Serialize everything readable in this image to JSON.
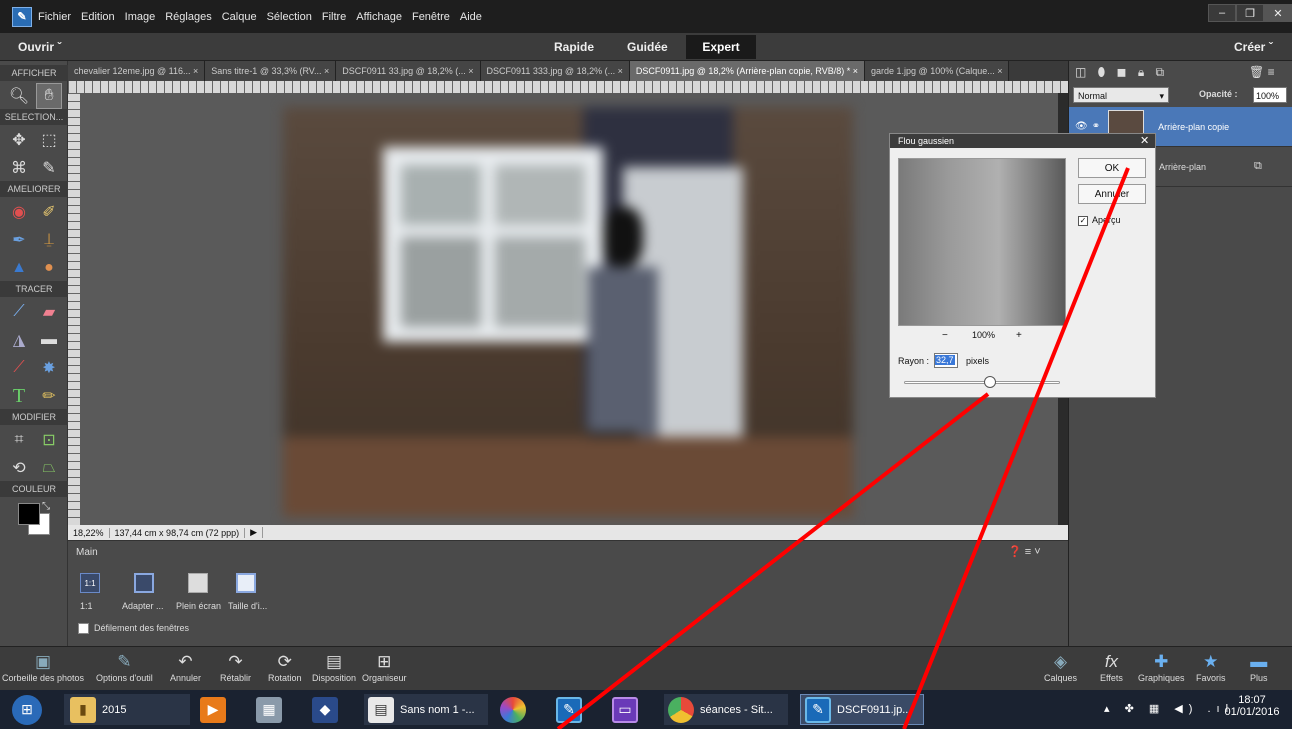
{
  "menu": {
    "items": [
      "Fichier",
      "Edition",
      "Image",
      "Réglages",
      "Calque",
      "Sélection",
      "Filtre",
      "Affichage",
      "Fenêtre",
      "Aide"
    ]
  },
  "modebar": {
    "open": "Ouvrir",
    "rapide": "Rapide",
    "guidee": "Guidée",
    "expert": "Expert",
    "create": "Créer"
  },
  "tools": {
    "sections": {
      "afficher": "AFFICHER",
      "selection": "SELECTION...",
      "ameliorer": "AMELIORER",
      "tracer": "TRACER",
      "modifier": "MODIFIER",
      "couleur": "COULEUR"
    }
  },
  "tabs": [
    {
      "label": "chevalier 12eme.jpg @ 116... ×"
    },
    {
      "label": "Sans titre-1 @ 33,3% (RV... ×"
    },
    {
      "label": "DSCF0911 33.jpg @ 18,2% (... ×"
    },
    {
      "label": "DSCF0911 333.jpg @ 18,2% (... ×"
    },
    {
      "label": "DSCF0911.jpg @ 18,2% (Arrière-plan copie, RVB/8) * ×"
    },
    {
      "label": "garde 1.jpg @ 100% (Calque... ×"
    }
  ],
  "status": {
    "zoom": "18,22%",
    "dims": "137,44 cm x 98,74 cm (72 ppp)"
  },
  "options": {
    "title": "Main",
    "btn_11": "1:1",
    "labels": {
      "b1": "1:1",
      "b2": "Adapter ...",
      "b3": "Plein écran",
      "b4": "Taille d'i..."
    },
    "scroll_label": "Défilement des fenêtres"
  },
  "layers": {
    "blend": "Normal",
    "opacity_label": "Opacité :",
    "opacity_value": "100%",
    "items": [
      {
        "name": "Arrière-plan copie"
      },
      {
        "name": "Arrière-plan"
      }
    ]
  },
  "dialog": {
    "title": "Flou gaussien",
    "ok": "OK",
    "cancel": "Annuler",
    "preview_label": "Aperçu",
    "preview_checked": true,
    "zoom_minus": "−",
    "zoom_value": "100%",
    "zoom_plus": "+",
    "radius_label": "Rayon :",
    "radius_value": "32,7",
    "radius_unit": "pixels",
    "slider_fraction": 0.55
  },
  "bottombar": {
    "items": [
      "Corbeille des photos",
      "Options d'outil",
      "Annuler",
      "Rétablir",
      "Rotation",
      "Disposition",
      "Organiseur"
    ],
    "right_items": [
      "Calques",
      "Effets",
      "Graphiques",
      "Favoris",
      "Plus"
    ]
  },
  "taskbar": {
    "folder": "2015",
    "app1": "Sans nom 1 -...",
    "chrome": "séances - Sit...",
    "ps": "DSCF0911.jp...",
    "time": "18:07",
    "date": "01/01/2016"
  }
}
